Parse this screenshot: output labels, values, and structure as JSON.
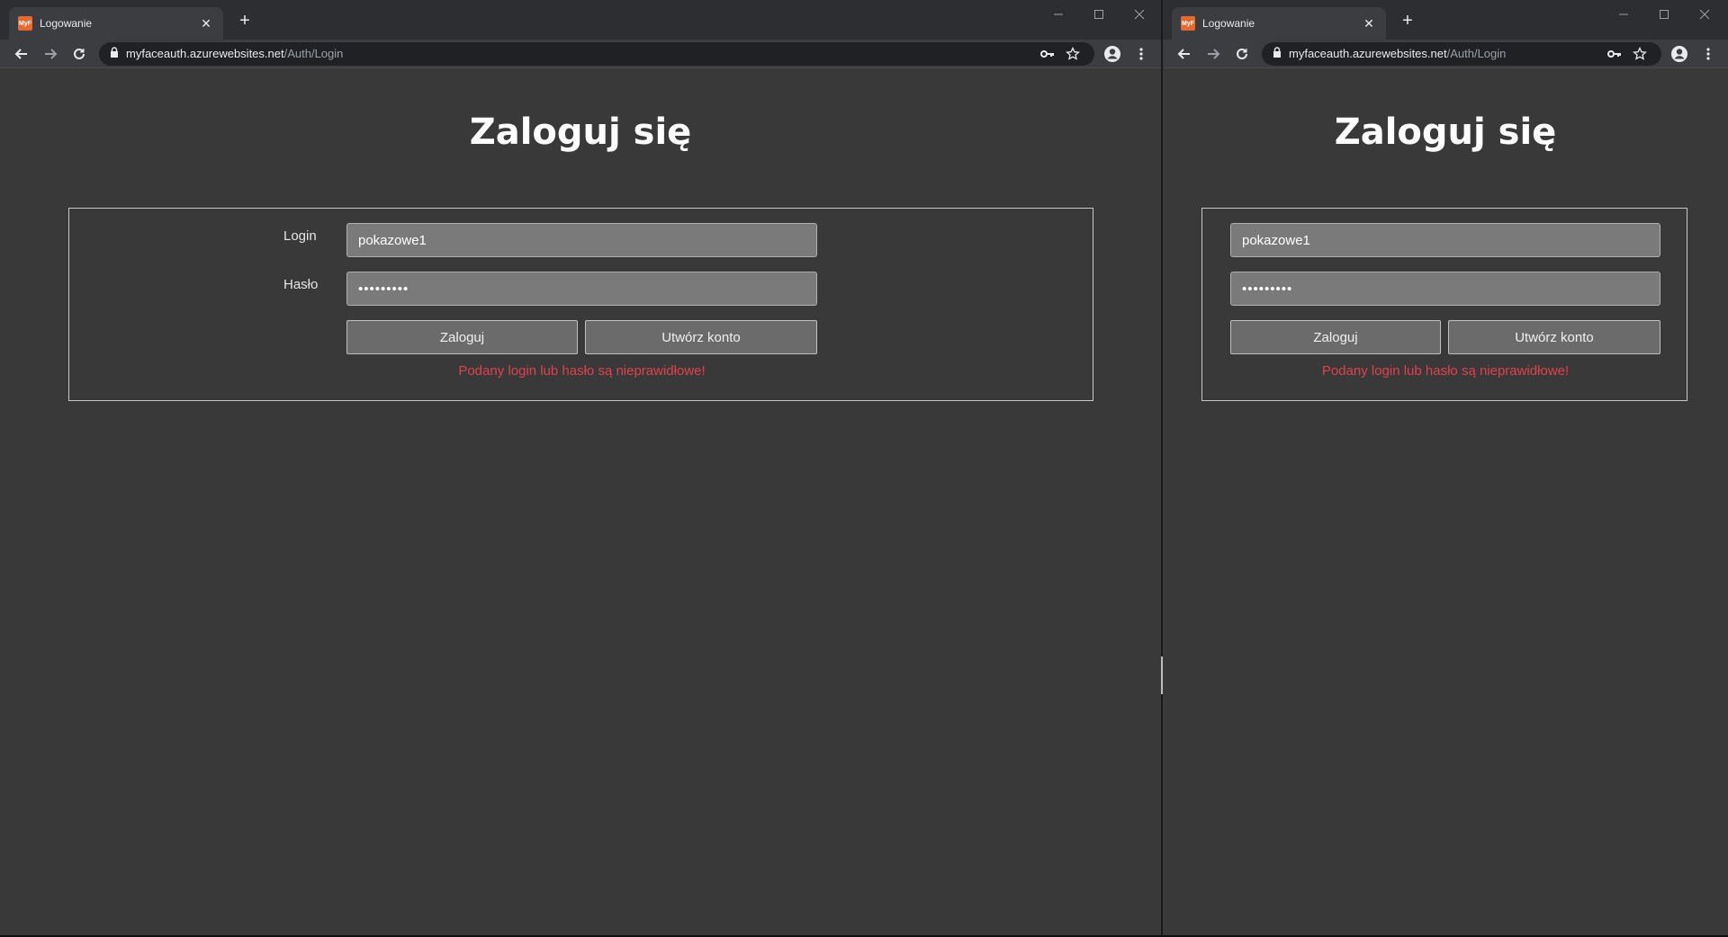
{
  "browser": {
    "tab_title": "Logowanie",
    "favicon_text": "MyF",
    "url_host": "myfaceauth.azurewebsites.net",
    "url_path": "/Auth/Login",
    "accent_favicon": "#e8692f"
  },
  "page": {
    "heading": "Zaloguj się",
    "login_label": "Login",
    "password_label": "Hasło",
    "login_value": "pokazowe1",
    "password_value": "•••••••••",
    "login_button": "Zaloguj",
    "register_button": "Utwórz konto",
    "error_message": "Podany login lub hasło są nieprawidłowe!",
    "error_color": "#e0414f"
  },
  "icons": [
    "back-icon",
    "forward-icon",
    "reload-icon",
    "lock-icon",
    "key-icon",
    "star-icon",
    "profile-icon",
    "menu-icon",
    "minimize-icon",
    "maximize-icon",
    "close-icon",
    "new-tab-icon"
  ]
}
